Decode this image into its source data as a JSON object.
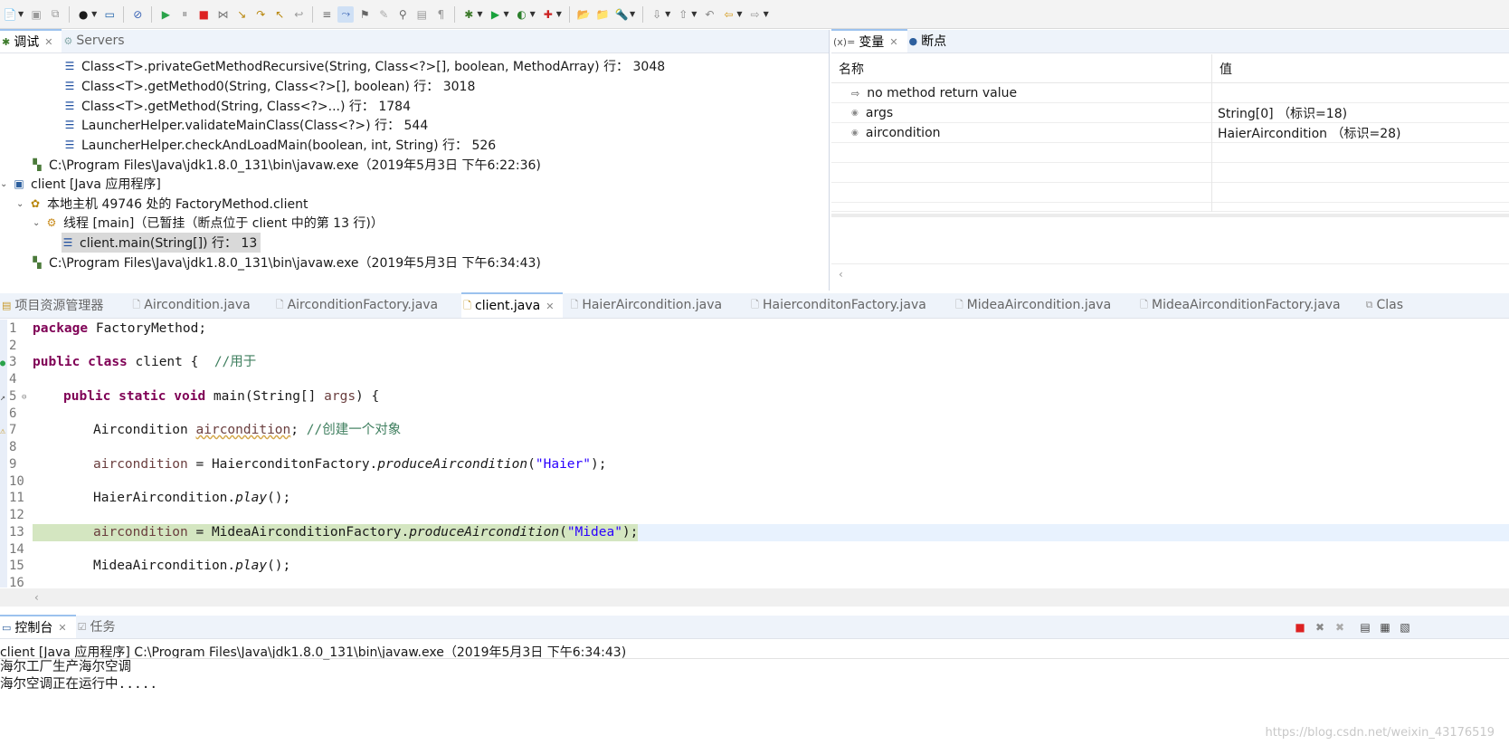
{
  "toolbar": {
    "icons": [
      "new-icon",
      "save-icon",
      "save-all-icon",
      "user-icon",
      "screen-icon",
      "skip-breakpoints-icon",
      "resume-icon",
      "suspend-icon",
      "terminate-icon",
      "disconnect-icon",
      "step-into-icon",
      "step-over-icon",
      "step-return-icon",
      "drop-to-frame-icon",
      "use-step-filters-icon",
      "debug-icon",
      "run-icon",
      "coverage-icon",
      "external-tools-icon",
      "open-type-icon",
      "open-task-icon",
      "search-icon",
      "next-annotation-icon",
      "prev-annotation-icon",
      "last-edit-icon",
      "back-icon",
      "forward-icon"
    ]
  },
  "debug_view": {
    "tabs": [
      {
        "label": "调试",
        "active": true
      },
      {
        "label": "Servers",
        "active": false
      }
    ],
    "tree": [
      {
        "text": "Class<T>.privateGetMethodRecursive(String, Class<?>[], boolean, MethodArray) 行： 3048",
        "icon": "stack-frame-icon"
      },
      {
        "text": "Class<T>.getMethod0(String, Class<?>[], boolean) 行： 3018",
        "icon": "stack-frame-icon"
      },
      {
        "text": "Class<T>.getMethod(String, Class<?>...) 行： 1784",
        "icon": "stack-frame-icon"
      },
      {
        "text": "LauncherHelper.validateMainClass(Class<?>) 行： 544",
        "icon": "stack-frame-icon"
      },
      {
        "text": "LauncherHelper.checkAndLoadMain(boolean, int, String) 行： 526",
        "icon": "stack-frame-icon"
      },
      {
        "text": "C:\\Program Files\\Java\\jdk1.8.0_131\\bin\\javaw.exe（2019年5月3日 下午6:22:36)",
        "icon": "process-icon"
      },
      {
        "text": "client [Java 应用程序]",
        "icon": "java-app-icon"
      },
      {
        "text": "本地主机 49746 处的 FactoryMethod.client",
        "icon": "debug-target-icon"
      },
      {
        "text": "线程 [main]（已暂挂（断点位于 client 中的第 13 行)）",
        "icon": "thread-suspended-icon"
      },
      {
        "text": "client.main(String[]) 行： 13",
        "icon": "stack-frame-icon"
      },
      {
        "text": "C:\\Program Files\\Java\\jdk1.8.0_131\\bin\\javaw.exe（2019年5月3日 下午6:34:43)",
        "icon": "process-icon"
      }
    ]
  },
  "variables_view": {
    "tabs": [
      {
        "label": "变量",
        "active": true
      },
      {
        "label": "断点",
        "active": false
      }
    ],
    "col_name": "名称",
    "col_value": "值",
    "rows": [
      {
        "name": "no method return value",
        "value": ""
      },
      {
        "name": "args",
        "value": "String[0]  （标识=18)"
      },
      {
        "name": "aircondition",
        "value": "HaierAircondition  （标识=28)"
      }
    ]
  },
  "editor": {
    "tabs": [
      {
        "label": "项目资源管理器",
        "active": false
      },
      {
        "label": "Aircondition.java",
        "active": false
      },
      {
        "label": "AirconditionFactory.java",
        "active": false
      },
      {
        "label": "client.java",
        "active": true
      },
      {
        "label": "HaierAircondition.java",
        "active": false
      },
      {
        "label": "HaierconditonFactory.java",
        "active": false
      },
      {
        "label": "MideaAircondition.java",
        "active": false
      },
      {
        "label": "MideaAirconditionFactory.java",
        "active": false
      },
      {
        "label": "Clas",
        "active": false
      }
    ],
    "line_numbers": [
      "1",
      "2",
      "3",
      "4",
      "5",
      "6",
      "7",
      "8",
      "9",
      "10",
      "11",
      "12",
      "13",
      "14",
      "15",
      "16"
    ],
    "code": {
      "l1_kw": "package",
      "l1_rest": " FactoryMethod;",
      "l3_kw1": "public",
      "l3_kw2": "class",
      "l3_rest": " client {  ",
      "l3_cm": "//用于",
      "l5_kw1": "public",
      "l5_kw2": "static",
      "l5_kw3": "void",
      "l5_rest1": " main(String[] ",
      "l5_param": "args",
      "l5_rest2": ") {",
      "l7_type": "Aircondition ",
      "l7_var": "aircondition",
      "l7_rest": "; ",
      "l7_cm": "//创建一个对象",
      "l9_var": "aircondition",
      "l9_rest": " = HaierconditonFactory.",
      "l9_method": "produceAircondition",
      "l9_open": "(",
      "l9_str": "\"Haier\"",
      "l9_close": ");",
      "l11_cls": "HaierAircondition.",
      "l11_method": "play",
      "l11_rest": "();",
      "l13_var": "aircondition",
      "l13_rest": " = MideaAirconditionFactory.",
      "l13_method": "produceAircondition",
      "l13_open": "(",
      "l13_str": "\"Midea\"",
      "l13_close": ");",
      "l15_cls": "MideaAircondition.",
      "l15_method": "play",
      "l15_rest": "();"
    }
  },
  "console": {
    "tabs": [
      {
        "label": "控制台",
        "active": true
      },
      {
        "label": "任务",
        "active": false
      }
    ],
    "title": "client [Java 应用程序] C:\\Program Files\\Java\\jdk1.8.0_131\\bin\\javaw.exe（2019年5月3日 下午6:34:43)",
    "output": [
      "海尔工厂生产海尔空调",
      "海尔空调正在运行中....."
    ]
  },
  "watermark": "https://blog.csdn.net/weixin_43176519",
  "colors": {
    "current_line_highlight": "#d4e6c1",
    "keyword": "#7f0055",
    "comment": "#3f7f5f",
    "string": "#2a00ff",
    "active_tab_border": "#9cc2ee"
  }
}
